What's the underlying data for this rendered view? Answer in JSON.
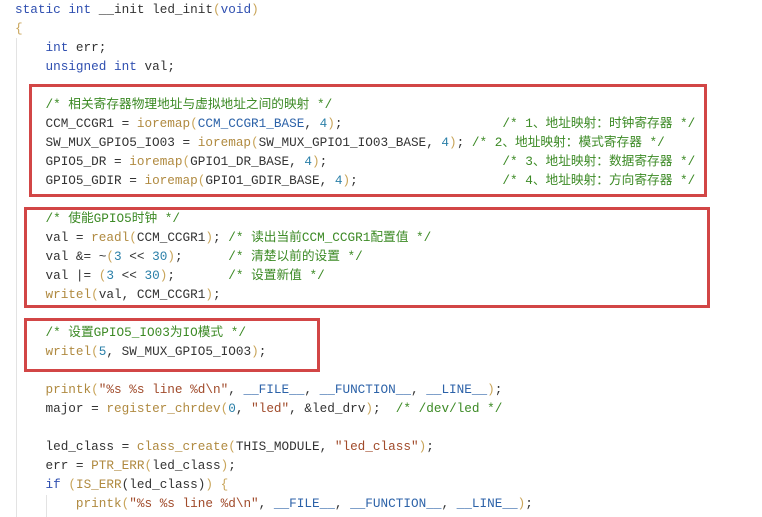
{
  "colors": {
    "highlight_box": "#d24646",
    "keyword": "#2f4fb0",
    "comment": "#3c8a25",
    "function": "#b08a40",
    "string": "#a04a2a",
    "number": "#2a7fa8"
  },
  "lines": [
    [
      [
        "kw",
        "static"
      ],
      [
        "pun",
        " "
      ],
      [
        "kw",
        "int"
      ],
      [
        "pun",
        " "
      ],
      [
        "id",
        "__init"
      ],
      [
        "pun",
        " "
      ],
      [
        "id",
        "led_init"
      ],
      [
        "paren",
        "("
      ],
      [
        "kw",
        "void"
      ],
      [
        "paren",
        ")"
      ]
    ],
    [
      [
        "paren",
        "{"
      ]
    ],
    [
      [
        "pun",
        "    "
      ],
      [
        "kw",
        "int"
      ],
      [
        "id",
        " err;"
      ]
    ],
    [
      [
        "pun",
        "    "
      ],
      [
        "kw",
        "unsigned"
      ],
      [
        "pun",
        " "
      ],
      [
        "kw",
        "int"
      ],
      [
        "id",
        " val;"
      ]
    ],
    [],
    [
      [
        "pun",
        "    "
      ],
      [
        "cmt",
        "/* 相关寄存器物理地址与虚拟地址之间的映射 */"
      ]
    ],
    [
      [
        "pun",
        "    "
      ],
      [
        "id",
        "CCM_CCGR1 = "
      ],
      [
        "fn",
        "ioremap"
      ],
      [
        "paren",
        "("
      ],
      [
        "mac",
        "CCM_CCGR1_BASE"
      ],
      [
        "pun",
        ", "
      ],
      [
        "num",
        "4"
      ],
      [
        "paren",
        ")"
      ],
      [
        "pun",
        ";                     "
      ],
      [
        "cmt",
        "/* 1、地址映射：时钟寄存器 */"
      ]
    ],
    [
      [
        "pun",
        "    "
      ],
      [
        "id",
        "SW_MUX_GPIO5_IO03 = "
      ],
      [
        "fn",
        "ioremap"
      ],
      [
        "paren",
        "("
      ],
      [
        "id",
        "SW_MUX_GPIO1_IO03_BASE"
      ],
      [
        "pun",
        ", "
      ],
      [
        "num",
        "4"
      ],
      [
        "paren",
        ")"
      ],
      [
        "pun",
        "; "
      ],
      [
        "cmt",
        "/* 2、地址映射：模式寄存器 */"
      ]
    ],
    [
      [
        "pun",
        "    "
      ],
      [
        "id",
        "GPIO5_DR = "
      ],
      [
        "fn",
        "ioremap"
      ],
      [
        "paren",
        "("
      ],
      [
        "id",
        "GPIO1_DR_BASE"
      ],
      [
        "pun",
        ", "
      ],
      [
        "num",
        "4"
      ],
      [
        "paren",
        ")"
      ],
      [
        "pun",
        ";                       "
      ],
      [
        "cmt",
        "/* 3、地址映射：数据寄存器 */"
      ]
    ],
    [
      [
        "pun",
        "    "
      ],
      [
        "id",
        "GPIO5_GDIR = "
      ],
      [
        "fn",
        "ioremap"
      ],
      [
        "paren",
        "("
      ],
      [
        "id",
        "GPIO1_GDIR_BASE"
      ],
      [
        "pun",
        ", "
      ],
      [
        "num",
        "4"
      ],
      [
        "paren",
        ")"
      ],
      [
        "pun",
        ";                   "
      ],
      [
        "cmt",
        "/* 4、地址映射：方向寄存器 */"
      ]
    ],
    [],
    [
      [
        "pun",
        "    "
      ],
      [
        "cmt",
        "/* 使能GPIO5时钟 */"
      ]
    ],
    [
      [
        "pun",
        "    "
      ],
      [
        "id",
        "val = "
      ],
      [
        "fn",
        "readl"
      ],
      [
        "paren",
        "("
      ],
      [
        "id",
        "CCM_CCGR1"
      ],
      [
        "paren",
        ")"
      ],
      [
        "pun",
        "; "
      ],
      [
        "cmt",
        "/* 读出当前CCM_CCGR1配置值 */"
      ]
    ],
    [
      [
        "pun",
        "    "
      ],
      [
        "id",
        "val &= ~"
      ],
      [
        "paren",
        "("
      ],
      [
        "num",
        "3"
      ],
      [
        "id",
        " << "
      ],
      [
        "num",
        "30"
      ],
      [
        "paren",
        ")"
      ],
      [
        "pun",
        ";      "
      ],
      [
        "cmt",
        "/* 清楚以前的设置 */"
      ]
    ],
    [
      [
        "pun",
        "    "
      ],
      [
        "id",
        "val |= "
      ],
      [
        "paren",
        "("
      ],
      [
        "num",
        "3"
      ],
      [
        "id",
        " << "
      ],
      [
        "num",
        "30"
      ],
      [
        "paren",
        ")"
      ],
      [
        "pun",
        ";       "
      ],
      [
        "cmt",
        "/* 设置新值 */"
      ]
    ],
    [
      [
        "pun",
        "    "
      ],
      [
        "fn",
        "writel"
      ],
      [
        "paren",
        "("
      ],
      [
        "id",
        "val, CCM_CCGR1"
      ],
      [
        "paren",
        ")"
      ],
      [
        "pun",
        ";"
      ]
    ],
    [],
    [
      [
        "pun",
        "    "
      ],
      [
        "cmt",
        "/* 设置GPIO5_IO03为IO模式 */"
      ]
    ],
    [
      [
        "pun",
        "    "
      ],
      [
        "fn",
        "writel"
      ],
      [
        "paren",
        "("
      ],
      [
        "num",
        "5"
      ],
      [
        "id",
        ", SW_MUX_GPIO5_IO03"
      ],
      [
        "paren",
        ")"
      ],
      [
        "pun",
        ";"
      ]
    ],
    [],
    [
      [
        "pun",
        "    "
      ],
      [
        "fn",
        "printk"
      ],
      [
        "paren",
        "("
      ],
      [
        "str",
        "\"%s %s line %d\\n\""
      ],
      [
        "pun",
        ", "
      ],
      [
        "mac",
        "__FILE__"
      ],
      [
        "pun",
        ", "
      ],
      [
        "mac",
        "__FUNCTION__"
      ],
      [
        "pun",
        ", "
      ],
      [
        "mac",
        "__LINE__"
      ],
      [
        "paren",
        ")"
      ],
      [
        "pun",
        ";"
      ]
    ],
    [
      [
        "pun",
        "    "
      ],
      [
        "id",
        "major = "
      ],
      [
        "fn",
        "register_chrdev"
      ],
      [
        "paren",
        "("
      ],
      [
        "num",
        "0"
      ],
      [
        "pun",
        ", "
      ],
      [
        "str",
        "\"led\""
      ],
      [
        "pun",
        ", &led_drv"
      ],
      [
        "paren",
        ")"
      ],
      [
        "pun",
        ";  "
      ],
      [
        "cmt",
        "/* /dev/led */"
      ]
    ],
    [],
    [
      [
        "pun",
        "    "
      ],
      [
        "id",
        "led_class = "
      ],
      [
        "fn",
        "class_create"
      ],
      [
        "paren",
        "("
      ],
      [
        "id",
        "THIS_MODULE"
      ],
      [
        "pun",
        ", "
      ],
      [
        "str",
        "\"led_class\""
      ],
      [
        "paren",
        ")"
      ],
      [
        "pun",
        ";"
      ]
    ],
    [
      [
        "pun",
        "    "
      ],
      [
        "id",
        "err = "
      ],
      [
        "fn",
        "PTR_ERR"
      ],
      [
        "paren",
        "("
      ],
      [
        "id",
        "led_class"
      ],
      [
        "paren",
        ")"
      ],
      [
        "pun",
        ";"
      ]
    ],
    [
      [
        "pun",
        "    "
      ],
      [
        "kw",
        "if"
      ],
      [
        "pun",
        " "
      ],
      [
        "paren",
        "("
      ],
      [
        "fn",
        "IS_ERR"
      ],
      [
        "pun",
        "("
      ],
      [
        "id",
        "led_class"
      ],
      [
        "pun",
        ")"
      ],
      [
        "paren",
        ")"
      ],
      [
        "pun",
        " "
      ],
      [
        "paren",
        "{"
      ]
    ],
    [
      [
        "pun",
        "        "
      ],
      [
        "fn",
        "printk"
      ],
      [
        "paren",
        "("
      ],
      [
        "str",
        "\"%s %s line %d\\n\""
      ],
      [
        "pun",
        ", "
      ],
      [
        "mac",
        "__FILE__"
      ],
      [
        "pun",
        ", "
      ],
      [
        "mac",
        "__FUNCTION__"
      ],
      [
        "pun",
        ", "
      ],
      [
        "mac",
        "__LINE__"
      ],
      [
        "paren",
        ")"
      ],
      [
        "pun",
        ";"
      ]
    ]
  ]
}
